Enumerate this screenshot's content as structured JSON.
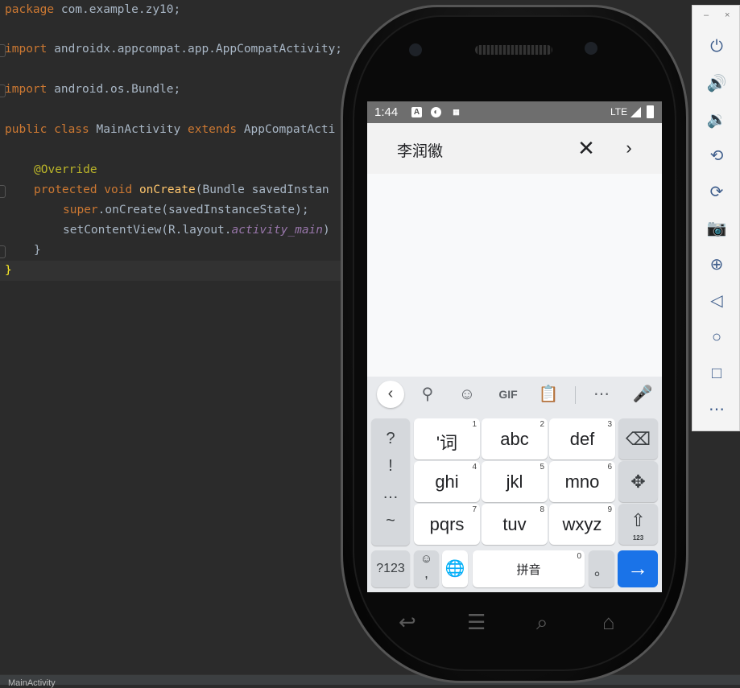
{
  "editor": {
    "lines": [
      {
        "text": "package com.example.zy10;"
      },
      {
        "text": "import androidx.appcompat.app.AppCompatActivity;"
      },
      {
        "text": "import android.os.Bundle;"
      },
      {
        "kw1": "public class",
        "name": " MainActivity ",
        "kw2": "extends",
        "rest": " AppCompatActi"
      },
      {
        "text": "@Override"
      },
      {
        "kw": "protected void",
        "fn": " onCreate",
        "rest": "(Bundle savedInstan"
      },
      {
        "kw": "super",
        "rest": ".onCreate(savedInstanceState);"
      },
      {
        "a": "setContentView(R.layout.",
        "it": "activity_main",
        "b": ")"
      },
      {
        "text": "}"
      },
      {
        "text": "}"
      }
    ],
    "status_text": "MainActivity"
  },
  "phone": {
    "status_bar": {
      "time": "1:44",
      "network": "LTE"
    },
    "app_bar": {
      "title": "李润徽",
      "close_icon": "close-icon",
      "next_icon": "chevron-right-icon"
    },
    "keyboard": {
      "toolbar": [
        "back-icon",
        "search-icon",
        "sticker-icon",
        "GIF",
        "clipboard-icon",
        "more-icon",
        "mic-icon"
      ],
      "gif_label": "GIF",
      "symbols": [
        "?",
        "!",
        "…",
        "~"
      ],
      "keys": [
        {
          "label": "'词",
          "num": "1"
        },
        {
          "label": "abc",
          "num": "2"
        },
        {
          "label": "def",
          "num": "3"
        },
        {
          "label": "ghi",
          "num": "4"
        },
        {
          "label": "jkl",
          "num": "5"
        },
        {
          "label": "mno",
          "num": "6"
        },
        {
          "label": "pqrs",
          "num": "7"
        },
        {
          "label": "tuv",
          "num": "8"
        },
        {
          "label": "wxyz",
          "num": "9"
        }
      ],
      "shift_sub": "123",
      "bottom": {
        "sym": "?123",
        "emoji_sub": ",",
        "space": "拼音",
        "space_num": "0",
        "period": "。"
      },
      "accent": "#1a73e8"
    }
  },
  "control_panel": {
    "buttons": [
      "power-icon",
      "volume-up-icon",
      "volume-down-icon",
      "rotate-left-icon",
      "rotate-right-icon",
      "camera-icon",
      "zoom-icon",
      "back-icon",
      "home-icon",
      "overview-icon",
      "more-icon"
    ],
    "min_label": "–",
    "close_label": "×"
  }
}
